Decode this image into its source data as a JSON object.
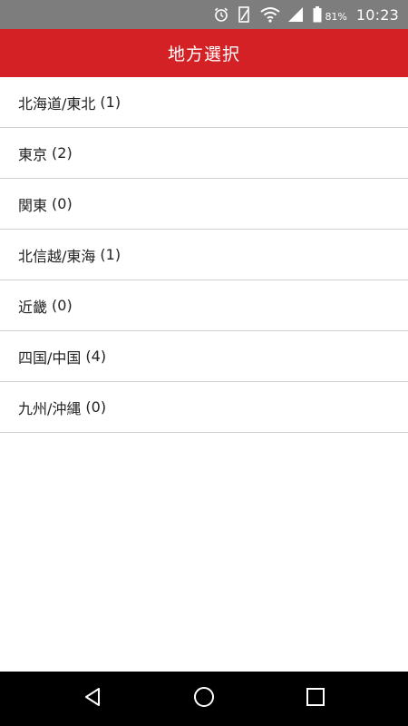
{
  "status_bar": {
    "battery_percent": "81%",
    "time": "10:23",
    "icons": [
      "alarm-icon",
      "battery-saver-icon",
      "wifi-icon",
      "signal-icon",
      "battery-icon"
    ]
  },
  "toolbar": {
    "title": "地方選択"
  },
  "regions": [
    {
      "label": "北海道/東北",
      "count": "(1)"
    },
    {
      "label": "東京",
      "count": "(2)"
    },
    {
      "label": "関東",
      "count": "(0)"
    },
    {
      "label": "北信越/東海",
      "count": "(1)"
    },
    {
      "label": "近畿",
      "count": "(0)"
    },
    {
      "label": "四国/中国",
      "count": "(4)"
    },
    {
      "label": "九州/沖縄",
      "count": "(0)"
    }
  ],
  "nav_bar": {
    "icons": [
      "back-icon",
      "home-icon",
      "recents-icon"
    ]
  },
  "colors": {
    "status_bar": "#7d7d7d",
    "toolbar": "#d32125",
    "divider": "#cfcfcf",
    "nav_bar": "#000000"
  }
}
